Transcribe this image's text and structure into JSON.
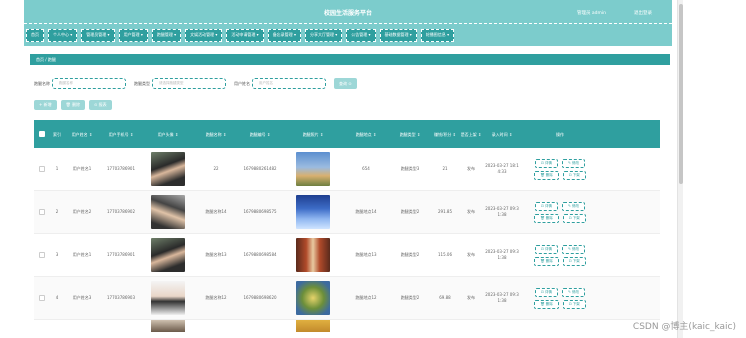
{
  "header": {
    "title": "校园生活服务平台",
    "admin": "管理员 admin",
    "logout": "退出登录"
  },
  "nav": [
    "首页",
    "个人中心 ▾",
    "管理员管理 ▾",
    "用户管理 ▾",
    "跑腿管理 ▾",
    "文娱活动管理 ▾",
    "活动申请管理 ▾",
    "备忘录管理 ▾",
    "分享大厅管理 ▾",
    "公告管理 ▾",
    "基础数据管理 ▾",
    "轮播图信息 ▾"
  ],
  "breadcrumb": "首页 / 跑腿",
  "filters": {
    "f1_label": "跑腿名称",
    "f1_placeholder": "跑腿名称",
    "f2_label": "跑腿类型",
    "f2_placeholder": "请选择跑腿类型",
    "f3_label": "用户姓名",
    "f3_placeholder": "用户姓名",
    "search": "查询 ⊙"
  },
  "actions": {
    "add": "+ 新增",
    "delete": "🗑 删除",
    "report": "⊙ 报表"
  },
  "columns": [
    "",
    "索引",
    "用户姓名 ⇕",
    "用户手机号 ⇕",
    "用户头像 ⇕",
    "跑腿名称 ⇕",
    "跑腿编号 ⇕",
    "跑腿照片 ⇕",
    "跑腿地点 ⇕",
    "跑腿类型 ⇕",
    "赚钱/积分 ⇕",
    "是否上架 ⇕",
    "录入时间 ⇕",
    "操作"
  ],
  "rows": [
    {
      "idx": "1",
      "name": "用户姓名1",
      "phone": "17703786901",
      "title": "22",
      "code": "1679880261482",
      "place": "654",
      "type": "跑腿类型3",
      "price": "21",
      "shelf": "发布",
      "time": "2023-03-27 18:14:33"
    },
    {
      "idx": "2",
      "name": "用户姓名2",
      "phone": "17703786902",
      "title": "跑腿名称14",
      "code": "1679880698575",
      "place": "跑腿地点14",
      "type": "跑腿类型2",
      "price": "291.85",
      "shelf": "发布",
      "time": "2023-03-27 09:31:38"
    },
    {
      "idx": "3",
      "name": "用户姓名1",
      "phone": "17703786901",
      "title": "跑腿名称13",
      "code": "1679880698584",
      "place": "跑腿地点13",
      "type": "跑腿类型2",
      "price": "115.06",
      "shelf": "发布",
      "time": "2023-03-27 09:31:38"
    },
    {
      "idx": "4",
      "name": "用户姓名3",
      "phone": "17703786903",
      "title": "跑腿名称12",
      "code": "1679880698620",
      "place": "跑腿地点12",
      "type": "跑腿类型2",
      "price": "69.88",
      "shelf": "发布",
      "time": "2023-03-27 09:31:38"
    }
  ],
  "ops": {
    "detail": "⊡ 详情",
    "edit": "✎ 修改",
    "del": "🗑 删除",
    "offshelf": "⊡ 下架"
  },
  "watermark": "CSDN @博主(kaic_kaic)"
}
